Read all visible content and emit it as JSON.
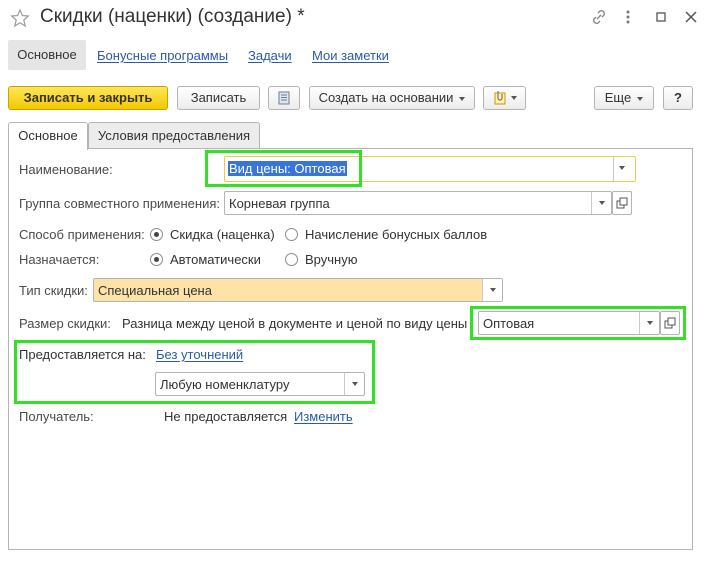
{
  "window": {
    "title": "Скидки (наценки) (создание) *"
  },
  "nav": {
    "active": "Основное",
    "links": [
      "Бонусные программы",
      "Задачи",
      "Мои заметки"
    ]
  },
  "toolbar": {
    "save_close": "Записать и закрыть",
    "save": "Записать",
    "create_based": "Создать на основании",
    "more": "Еще",
    "help": "?"
  },
  "tabs": [
    "Основное",
    "Условия предоставления"
  ],
  "form": {
    "name_label": "Наименование:",
    "name_value": "Вид цены: Оптовая",
    "group_label": "Группа совместного применения:",
    "group_value": "Корневая группа",
    "method_label": "Способ применения:",
    "method_options": [
      "Скидка (наценка)",
      "Начисление бонусных баллов"
    ],
    "assign_label": "Назначается:",
    "assign_options": [
      "Автоматически",
      "Вручную"
    ],
    "type_label": "Тип скидки:",
    "type_value": "Специальная цена",
    "size_label": "Размер скидки:",
    "size_desc": "Разница между ценой в документе и ценой по виду цены",
    "size_value": "Оптовая",
    "provided_label": "Предоставляется на:",
    "provided_link": "Без уточнений",
    "provided_value": "Любую номенклатуру",
    "recipient_label": "Получатель:",
    "recipient_value": "Не предоставляется",
    "recipient_link": "Изменить"
  },
  "colors": {
    "highlight": "#33e025",
    "primary_button": "#f5c800",
    "link": "#2b5aa8",
    "special_field": "#fde3a7",
    "focus_border": "#f2c84b",
    "selection": "#3875d7"
  }
}
